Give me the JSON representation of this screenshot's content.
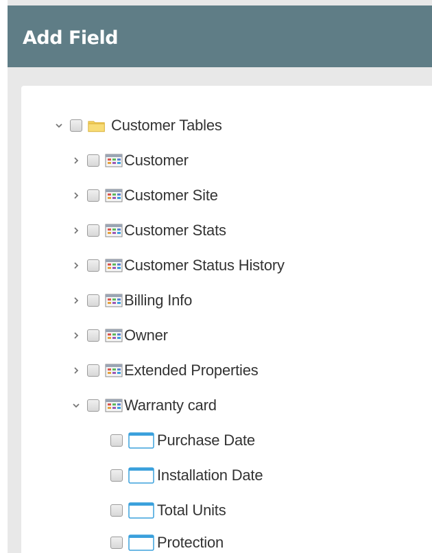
{
  "header": {
    "title": "Add Field"
  },
  "tree": {
    "root": {
      "label": "Customer Tables",
      "expanded": true,
      "icon": "folder-icon"
    },
    "tables": [
      {
        "label": "Customer",
        "expanded": false,
        "icon": "table-icon"
      },
      {
        "label": "Customer Site",
        "expanded": false,
        "icon": "table-icon"
      },
      {
        "label": "Customer Stats",
        "expanded": false,
        "icon": "table-icon"
      },
      {
        "label": "Customer Status History",
        "expanded": false,
        "icon": "table-icon"
      },
      {
        "label": "Billing Info",
        "expanded": false,
        "icon": "table-icon"
      },
      {
        "label": "Owner",
        "expanded": false,
        "icon": "table-icon"
      },
      {
        "label": "Extended Properties",
        "expanded": false,
        "icon": "table-icon"
      },
      {
        "label": "Warranty card",
        "expanded": true,
        "icon": "table-icon"
      }
    ],
    "fields": [
      {
        "label": "Purchase Date",
        "icon": "field-icon"
      },
      {
        "label": "Installation Date",
        "icon": "field-icon"
      },
      {
        "label": "Total Units",
        "icon": "field-icon"
      },
      {
        "label": "Protection",
        "icon": "field-icon"
      }
    ]
  },
  "colors": {
    "header_bg": "#5f7d86",
    "text": "#333333",
    "field_icon": "#3aa0dc",
    "folder": "#f3cf5b"
  }
}
